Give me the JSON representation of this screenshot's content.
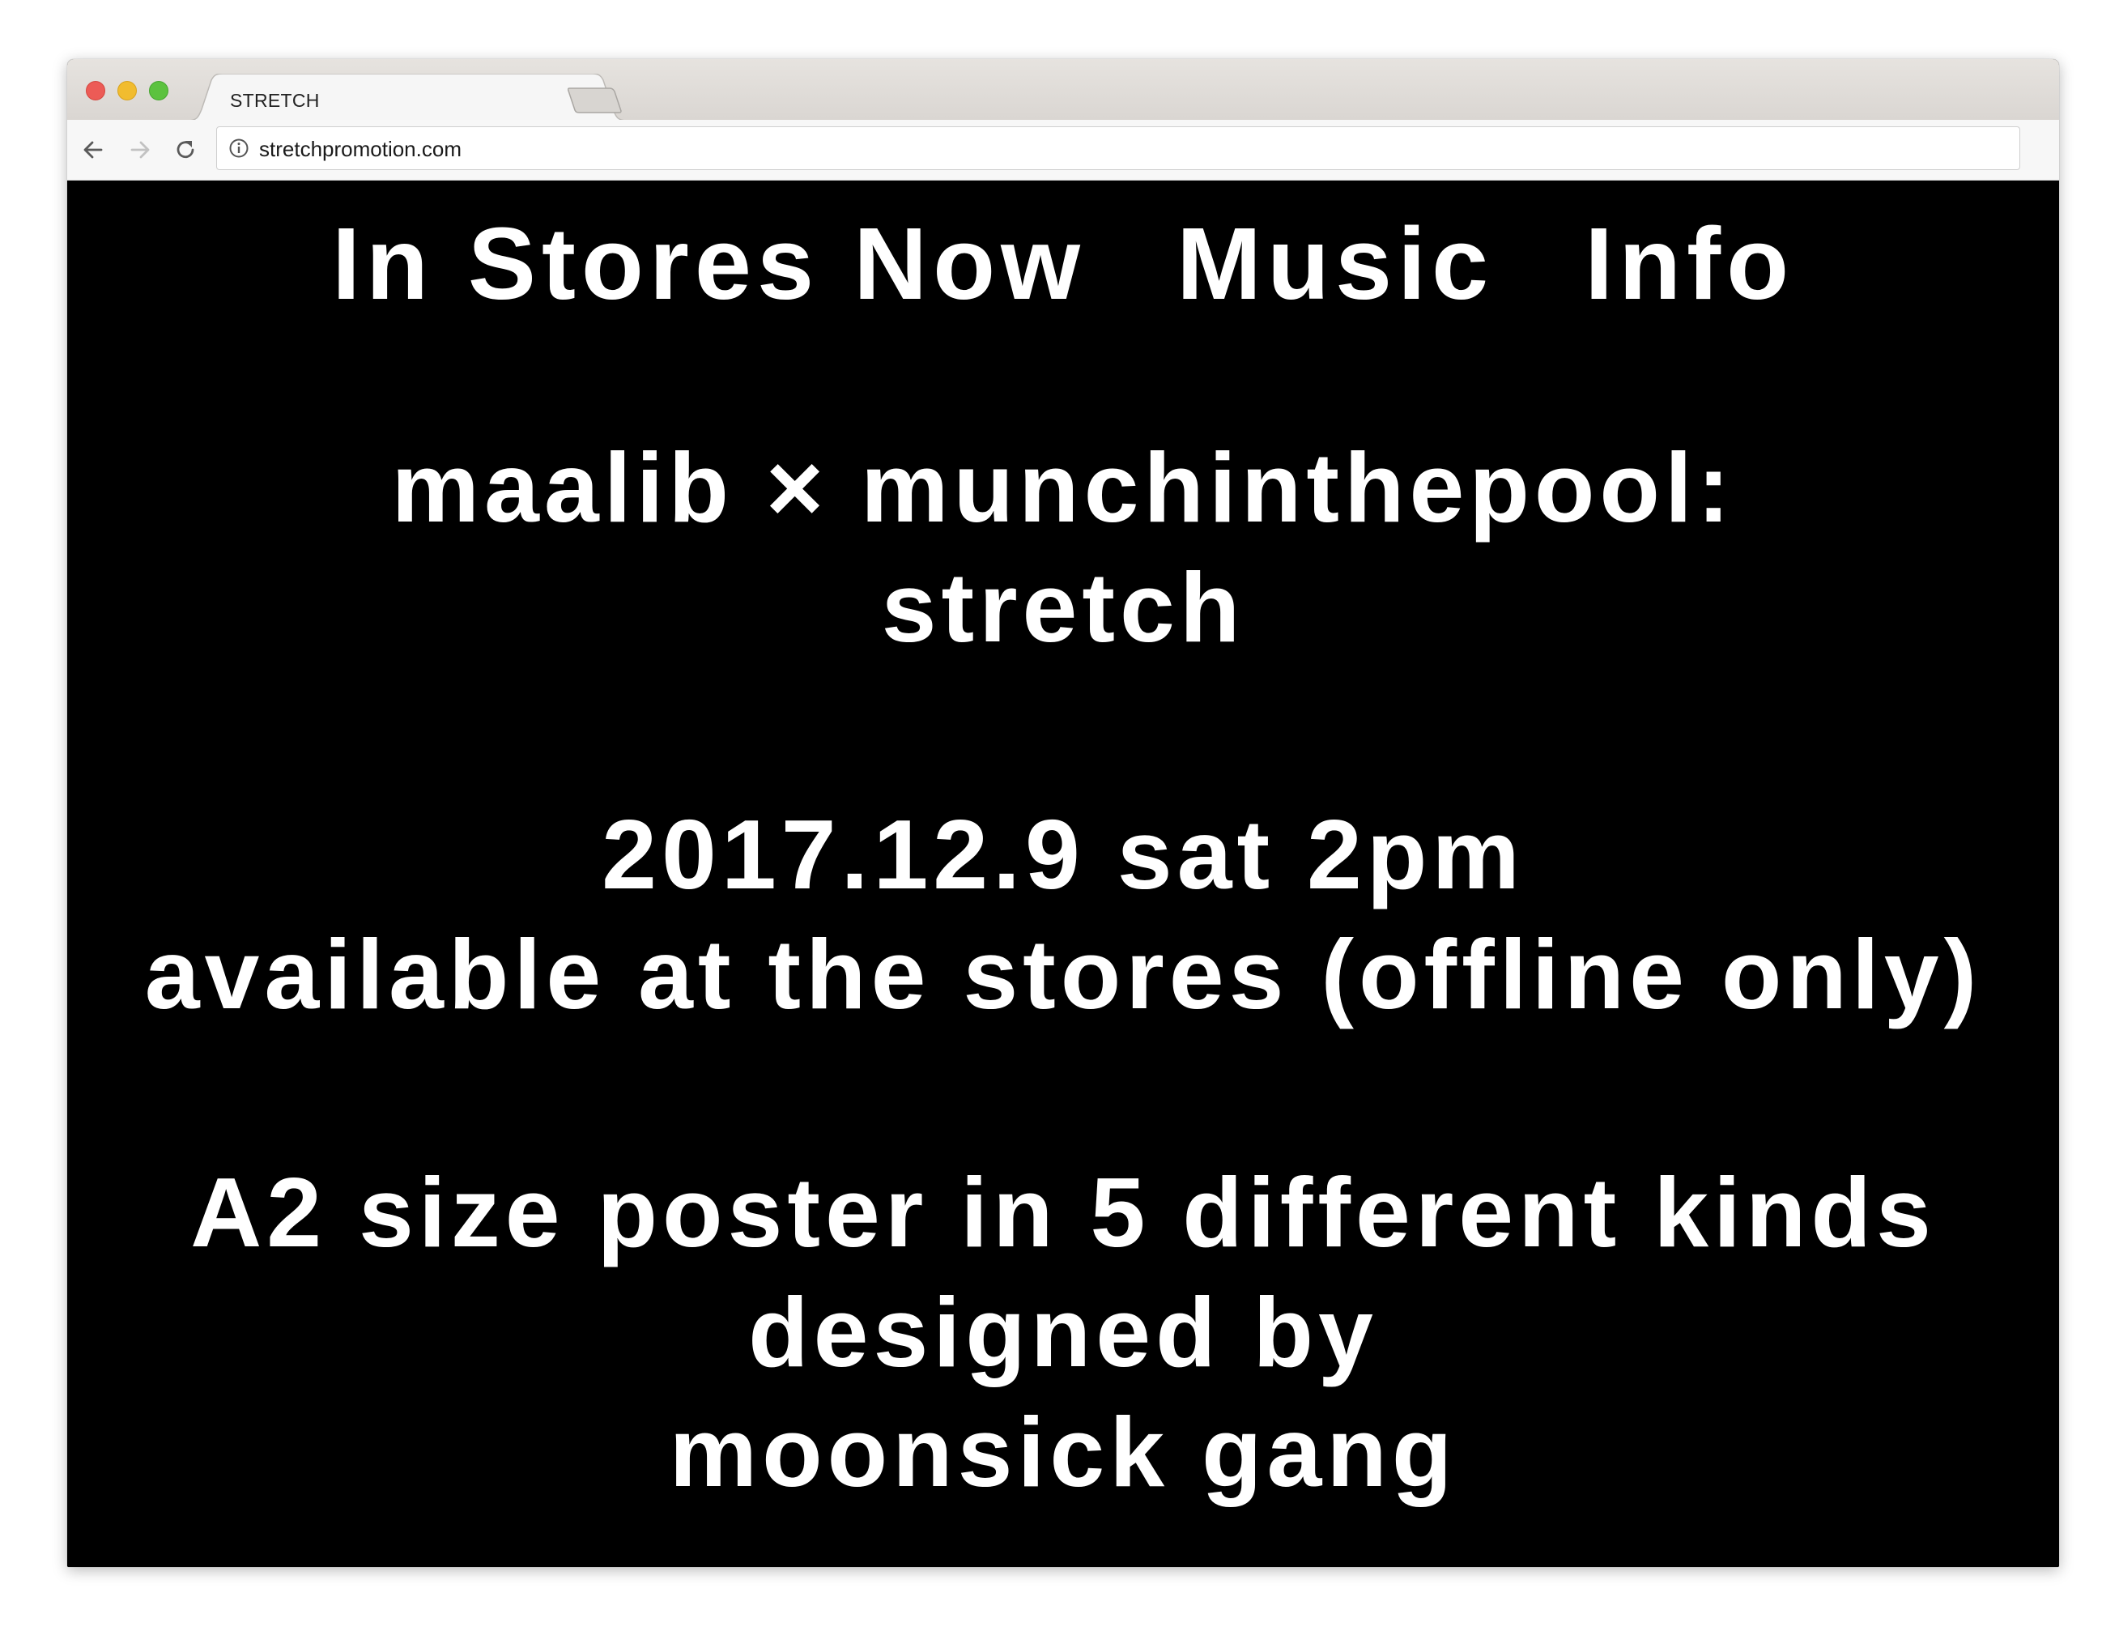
{
  "browser": {
    "tab_title": "STRETCH",
    "url": "stretchpromotion.com"
  },
  "nav": {
    "items": [
      {
        "label": "In Stores Now"
      },
      {
        "label": "Music"
      },
      {
        "label": "Info"
      }
    ]
  },
  "content": {
    "release_line1": "maalib × munchinthepool:",
    "release_line2": "stretch",
    "date_line": "2017.12.9 sat 2pm",
    "availability_line": "available at the stores (offline only)",
    "poster_line1": "A2 size poster in 5 different kinds",
    "poster_line2": "designed by",
    "poster_line3": "moonsick gang"
  },
  "colors": {
    "page_background": "#000000",
    "page_text": "#ffffff",
    "close_button": "#ec5b56",
    "minimize_button": "#f1bc2f",
    "zoom_button": "#5cc23f"
  }
}
